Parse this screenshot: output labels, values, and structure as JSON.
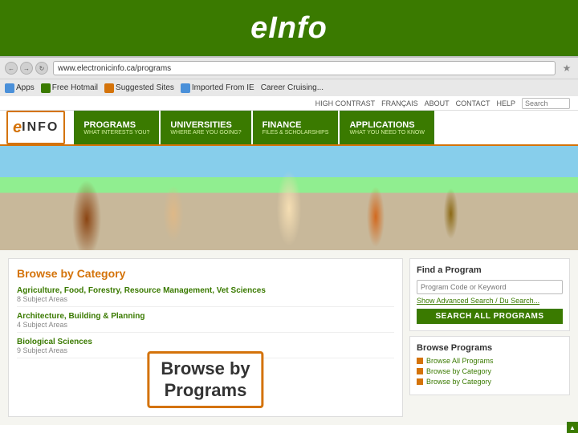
{
  "header": {
    "title": "eInfo",
    "background_color": "#3a7a00"
  },
  "browser": {
    "url": "www.electronicinfo.ca/programs",
    "bookmarks": [
      {
        "label": "Apps"
      },
      {
        "label": "Free Hotmail"
      },
      {
        "label": "Suggested Sites"
      },
      {
        "label": "Imported From IE"
      },
      {
        "label": "Career Cruising..."
      }
    ]
  },
  "utility_bar": {
    "items": [
      "HIGH CONTRAST",
      "FRANÇAIS",
      "ABOUT",
      "CONTACT",
      "HELP"
    ],
    "search_placeholder": "Search"
  },
  "nav": {
    "logo_e": "e",
    "logo_info": "INFO",
    "items": [
      {
        "label": "PROGRAMS",
        "sub": "WHAT INTERESTS YOU?"
      },
      {
        "label": "UNIVERSITIES",
        "sub": "WHERE ARE YOU GOING?"
      },
      {
        "label": "FINANCE",
        "sub": "FILES & SCHOLARSHIPS"
      },
      {
        "label": "APPLICATIONS",
        "sub": "WHAT YOU NEED TO KNOW"
      }
    ]
  },
  "content": {
    "left_panel": {
      "title": "Browse by Category",
      "categories": [
        {
          "title": "Agriculture, Food, Forestry, Resource Management, Vet Sciences",
          "sub": "8 Subject Areas"
        },
        {
          "title": "Architecture, Building & Planning",
          "sub": "4 Subject Areas"
        },
        {
          "title": "Biological Sciences",
          "sub": "9 Subject Areas"
        }
      ]
    },
    "highlight": {
      "line1": "Browse by",
      "line2": "Programs"
    },
    "right_panel": {
      "find_program": {
        "title": "Find a Program",
        "input_placeholder": "Program Code or Keyword",
        "advanced_link": "Show Advanced Search / Du Search...",
        "search_button": "SEARCH ALL PROGRAMS"
      },
      "browse_programs": {
        "title": "Browse Programs",
        "links": [
          "Browse All Programs",
          "Browse by Category",
          "Browse by Category"
        ]
      }
    }
  }
}
